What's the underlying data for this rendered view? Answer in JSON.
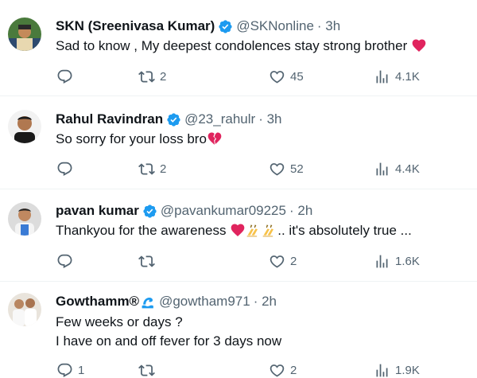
{
  "colors": {
    "text": "#0f1419",
    "secondary": "#536471",
    "verified": "#1d9bf0",
    "divider": "#eff3f4",
    "heart": "#e0245e"
  },
  "tweets": [
    {
      "name": "SKN (Sreenivasa Kumar)",
      "handle": "@SKNonline",
      "time": "· 3h",
      "text": "Sad to know , My deepest condolences stay strong brother",
      "text_emoji": "red-heart-emoji",
      "replies": "",
      "retweets": "2",
      "likes": "45",
      "views": "4.1K"
    },
    {
      "name": "Rahul Ravindran",
      "handle": "@23_rahulr",
      "time": "· 3h",
      "text": "So sorry for your loss bro",
      "text_emoji": "broken-heart-emoji",
      "replies": "",
      "retweets": "2",
      "likes": "52",
      "views": "4.4K"
    },
    {
      "name": "pavan kumar",
      "handle": "@pavankumar09225",
      "time": "· 2h",
      "text_before": "Thankyou for the awareness",
      "text_after": ".. it's absolutely true ...",
      "text_emoji": "heart-and-writing-hands-emoji",
      "replies": "",
      "retweets": "",
      "likes": "2",
      "views": "1.6K"
    },
    {
      "name": "Gowthamm®",
      "name_emoji": "wave-emoji",
      "handle": "@gowtham971",
      "time": "· 2h",
      "text_line1": "Few weeks or days ?",
      "text_line2": "I have on and off fever for 3 days now",
      "replies": "1",
      "retweets": "",
      "likes": "2",
      "views": "1.9K"
    }
  ]
}
